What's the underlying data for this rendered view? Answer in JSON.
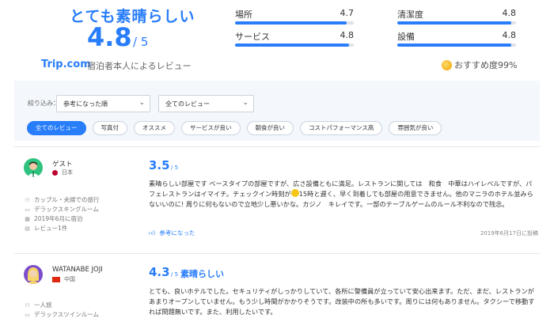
{
  "summary": {
    "verdict": "とても素晴らしい",
    "score": "4.8",
    "score_of": "/ 5",
    "logo": "Trip.com",
    "subtitle": "宿泊者本人によるレビュー",
    "categories": [
      {
        "label": "場所",
        "value": "4.7",
        "fraction": 0.94
      },
      {
        "label": "清潔度",
        "value": "4.8",
        "fraction": 0.96
      },
      {
        "label": "サービス",
        "value": "4.8",
        "fraction": 0.96
      },
      {
        "label": "設備",
        "value": "4.8",
        "fraction": 0.96
      }
    ],
    "recommend": "おすすめ度99%"
  },
  "filters": {
    "label": "絞り込み：",
    "sort_value": "参考になった順",
    "type_value": "全てのレビュー",
    "pills": [
      "全てのレビュー",
      "写真付",
      "オススメ",
      "サービスが良い",
      "朝食が良い",
      "コストパフォーマンス高",
      "雰囲気が良い"
    ],
    "active_pill": 0
  },
  "reviews": [
    {
      "user": "ゲスト",
      "country": "日本",
      "meta": [
        "カップル・夫婦での旅行",
        "デラックスキングルーム",
        "2019年6月に宿泊",
        "レビュー1件"
      ],
      "score": "3.5",
      "score_of": "/ 5",
      "title": "",
      "body_1": "素晴らしい部屋です ベースタイプの部屋ですが、広さ設備ともに満足。レストランに関しては　和食　中華はハイレベルですが、パフェレストランはイマイチ。チェックイン時刻が",
      "body_2": "15時と遅く、早く到着しても部屋の用意できません。他のマニラのホテル並みらないいのに! 周りに何もないので立地少し悪いかな。カジノ　キレイです。一部のテーブルゲームのルール不利なので残念。",
      "helpful": "参考になった",
      "date": "2019年6月17日に投稿"
    },
    {
      "user": "WATANABE JOJI",
      "country": "中国",
      "meta": [
        "一人旅",
        "デラックスツインルーム"
      ],
      "score": "4.3",
      "score_of": "/ 5",
      "title": "素晴らしい",
      "body_1": "とても、良いホテルでした。セキュリティがしっかりしていて、各所に警備員が立っていて安心出来ます。ただ、まだ、レストランがあまりオープンしていません。もう少し時間がかかりそうです。改装中の所も多いです。周りには何もありません。タクシーで移動すれば問題無いです。また、利用したいです。",
      "body_2": ""
    }
  ],
  "colors": {
    "accent": "#287dfa",
    "panel": "#f4f7fb",
    "bar_track": "#dfe3e8"
  },
  "icons": {
    "sort_chevron": "chevron-down-icon",
    "helpful": "thumbs-up-icon",
    "medal": "medal-icon"
  }
}
